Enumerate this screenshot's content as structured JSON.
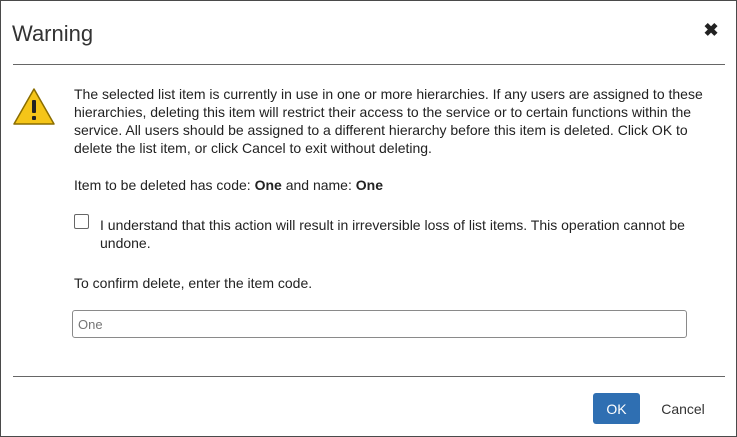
{
  "dialog": {
    "title": "Warning",
    "close_glyph": "✖",
    "message": "The selected list item is currently in use in one or more hierarchies. If any users are assigned to these hierarchies, deleting this item will restrict their access to the service or to certain functions within the service. All users should be assigned to a different hierarchy before this item is deleted. Click OK to delete the list item, or click Cancel to exit without deleting.",
    "item_info": {
      "prefix": "Item to be deleted has code: ",
      "code": "One",
      "middle": " and name: ",
      "name": "One"
    },
    "acknowledge_label": "I understand that this action will result in irreversible loss of list items. This operation cannot be undone.",
    "acknowledge_checked": false,
    "confirm_label": "To confirm delete, enter the item code.",
    "confirm_input": {
      "value": "",
      "placeholder": "One"
    },
    "ok_label": "OK",
    "cancel_label": "Cancel"
  },
  "icons": {
    "warning": "warning-triangle-icon",
    "close": "close-icon"
  },
  "colors": {
    "ok_button": "#2f6fb2",
    "warning_fill": "#f5c518",
    "border": "#4a4a4a"
  }
}
